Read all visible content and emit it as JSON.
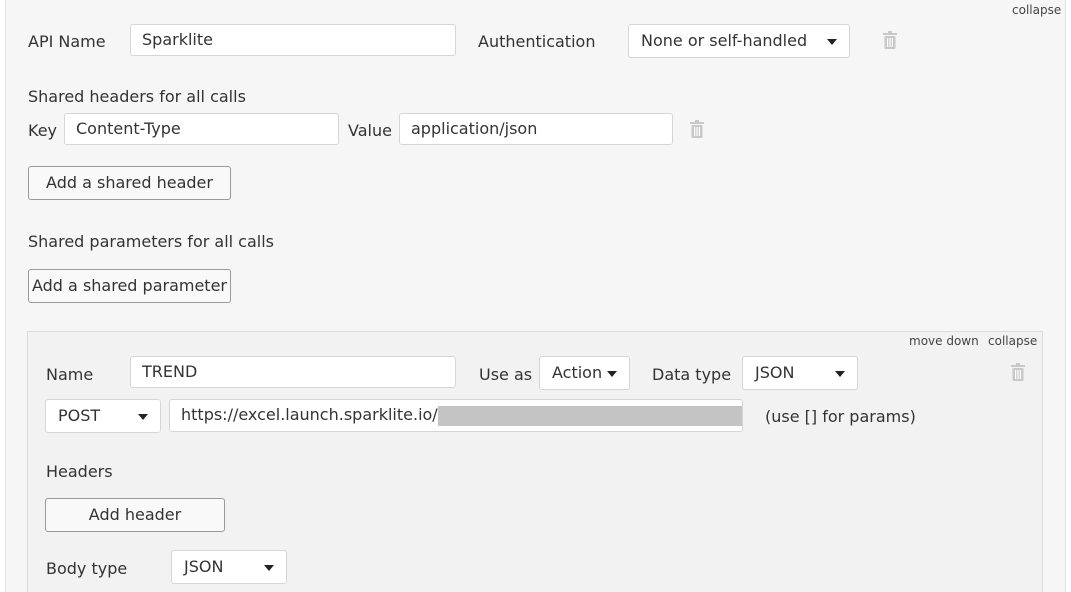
{
  "api": {
    "collapse_label": "collapse",
    "name_label": "API Name",
    "name_value": "Sparklite",
    "auth_label": "Authentication",
    "auth_value": "None or self-handled",
    "shared_headers_title": "Shared headers for all calls",
    "header_key_label": "Key",
    "header_key_value": "Content-Type",
    "header_value_label": "Value",
    "header_value_value": "application/json",
    "add_shared_header": "Add a shared header",
    "shared_params_title": "Shared parameters for all calls",
    "add_shared_param": "Add a shared parameter"
  },
  "call": {
    "move_down_label": "move down",
    "collapse_label": "collapse",
    "name_label": "Name",
    "name_value": "TREND",
    "use_as_label": "Use as",
    "use_as_value": "Action",
    "data_type_label": "Data type",
    "data_type_value": "JSON",
    "method_value": "POST",
    "url_value": "https://excel.launch.sparklite.io/",
    "url_hint": "(use [] for params)",
    "headers_title": "Headers",
    "add_header": "Add header",
    "body_type_label": "Body type",
    "body_type_value": "JSON"
  },
  "icons": {
    "trash": "trash-icon",
    "caret": "caret-down-icon"
  },
  "colors": {
    "panel_bg": "#f6f6f6",
    "inner_bg": "#f2f2f2",
    "border": "#d6d6d6",
    "icon": "#c8c8c8"
  }
}
